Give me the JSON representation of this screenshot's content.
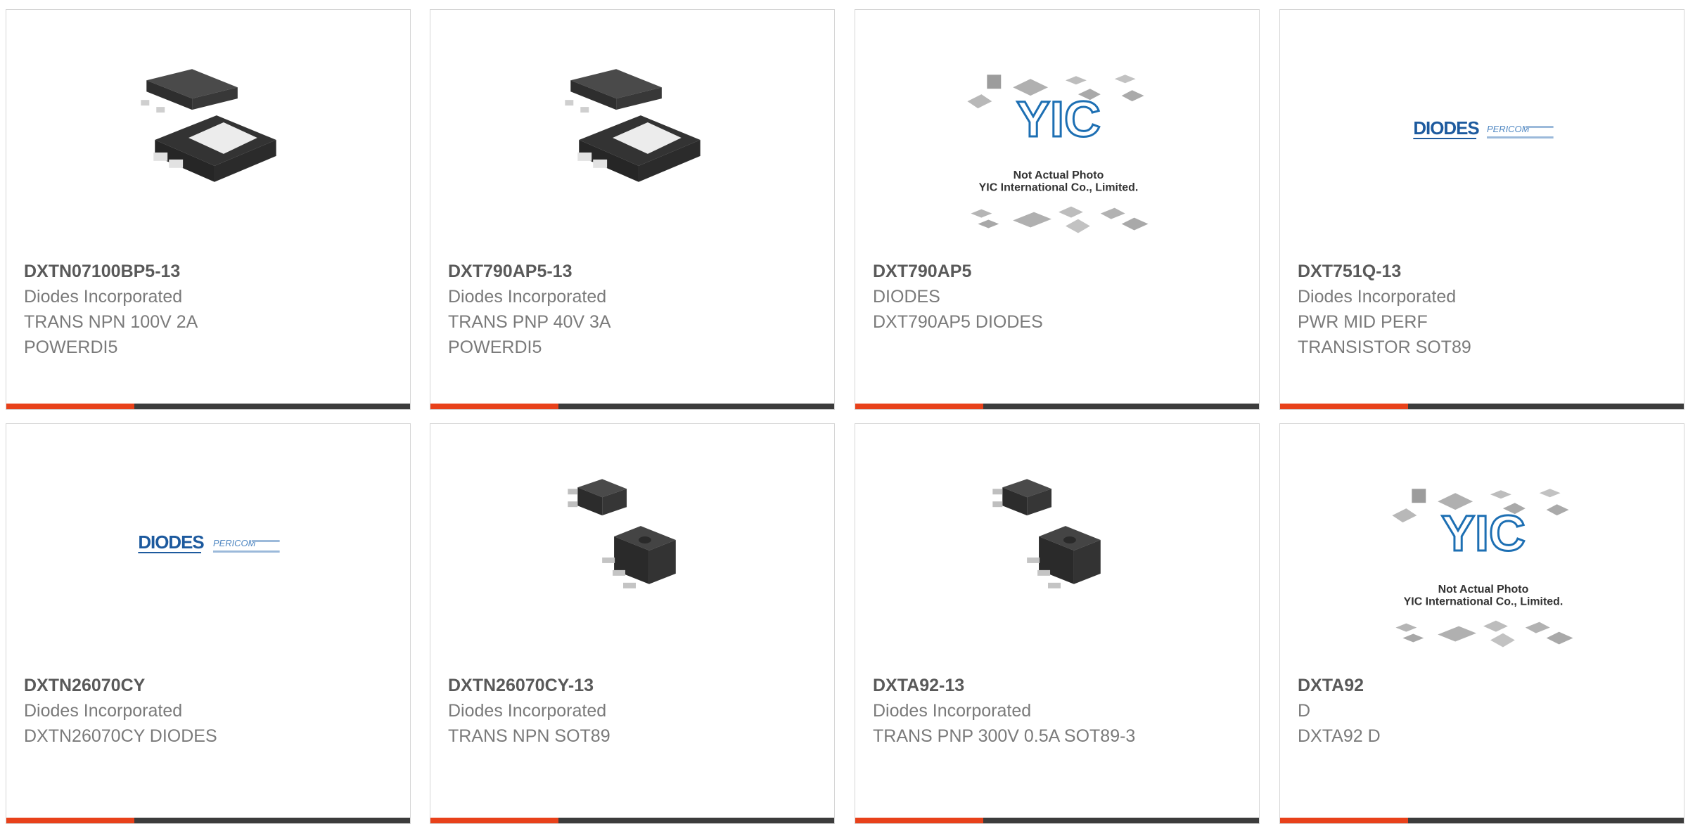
{
  "colors": {
    "accent": "#e8411a",
    "bar": "#3c3c3c",
    "part_text": "#595959",
    "body_text": "#7a7a7a",
    "brand_blue": "#1d5a9e"
  },
  "products": [
    {
      "part": "DXTN07100BP5-13",
      "mfr": "Diodes Incorporated",
      "desc": "TRANS NPN 100V 2A POWERDI5",
      "image": "powerdi5-package-photo"
    },
    {
      "part": "DXT790AP5-13",
      "mfr": "Diodes Incorporated",
      "desc": "TRANS PNP 40V 3A POWERDI5",
      "image": "powerdi5-package-photo"
    },
    {
      "part": "DXT790AP5",
      "mfr": "DIODES",
      "desc": "DXT790AP5 DIODES",
      "image": "not-actual-photo-placeholder",
      "placeholder": {
        "logo": "YIC",
        "line1": "Not Actual Photo",
        "line2": "YIC International Co., Limited."
      }
    },
    {
      "part": "DXT751Q-13",
      "mfr": "Diodes Incorporated",
      "desc": "PWR MID PERF TRANSISTOR SOT89",
      "image": "diodes-pericom-logo",
      "logo": {
        "brand1": "DIODES",
        "brand2": "PERICOM"
      }
    },
    {
      "part": "DXTN26070CY",
      "mfr": "Diodes Incorporated",
      "desc": "DXTN26070CY DIODES",
      "image": "diodes-pericom-logo",
      "logo": {
        "brand1": "DIODES",
        "brand2": "PERICOM"
      }
    },
    {
      "part": "DXTN26070CY-13",
      "mfr": "Diodes Incorporated",
      "desc": "TRANS NPN SOT89",
      "image": "sot89-package-photo"
    },
    {
      "part": "DXTA92-13",
      "mfr": "Diodes Incorporated",
      "desc": "TRANS PNP 300V 0.5A SOT89-3",
      "image": "sot89-package-photo"
    },
    {
      "part": "DXTA92",
      "mfr": "D",
      "desc": "DXTA92 D",
      "image": "not-actual-photo-placeholder",
      "placeholder": {
        "logo": "YIC",
        "line1": "Not Actual Photo",
        "line2": "YIC International Co., Limited."
      }
    }
  ]
}
